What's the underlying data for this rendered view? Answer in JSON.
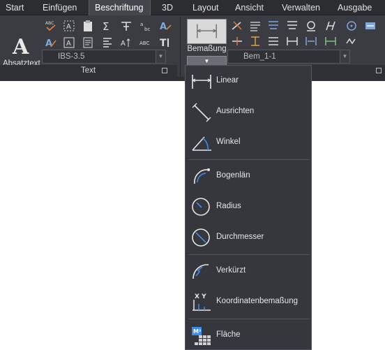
{
  "tabs": [
    {
      "label": "Start"
    },
    {
      "label": "Einfügen"
    },
    {
      "label": "Beschriftung"
    },
    {
      "label": "3D"
    },
    {
      "label": "Layout"
    },
    {
      "label": "Ansicht"
    },
    {
      "label": "Verwalten"
    },
    {
      "label": "Ausgabe"
    }
  ],
  "active_tab": "Beschriftung",
  "text_panel": {
    "title": "Text",
    "absatztext_label": "Absatztext",
    "style_combo_value": "IBS-3.5"
  },
  "dim_panel": {
    "bemassung_label": "Bemaßung",
    "dimstyle_combo_value": "Bem_1-1"
  },
  "menu": {
    "items": [
      {
        "label": "Linear",
        "icon": "linear-dimension-icon"
      },
      {
        "label": "Ausrichten",
        "icon": "aligned-dimension-icon"
      },
      {
        "label": "Winkel",
        "icon": "angular-dimension-icon"
      },
      {
        "label": "Bogenlän",
        "icon": "arc-length-icon"
      },
      {
        "label": "Radius",
        "icon": "radius-icon"
      },
      {
        "label": "Durchmesser",
        "icon": "diameter-icon"
      },
      {
        "label": "Verkürzt",
        "icon": "jogged-icon"
      },
      {
        "label": "Koordinatenbemaßung",
        "icon": "ordinate-icon"
      },
      {
        "label": "Fläche",
        "icon": "area-icon"
      }
    ]
  },
  "colors": {
    "ribbon_bg": "#3a3c42",
    "tab_bar_bg": "#2b2d31",
    "menu_bg": "#35373c",
    "accent_blue": "#3d8ee8"
  }
}
